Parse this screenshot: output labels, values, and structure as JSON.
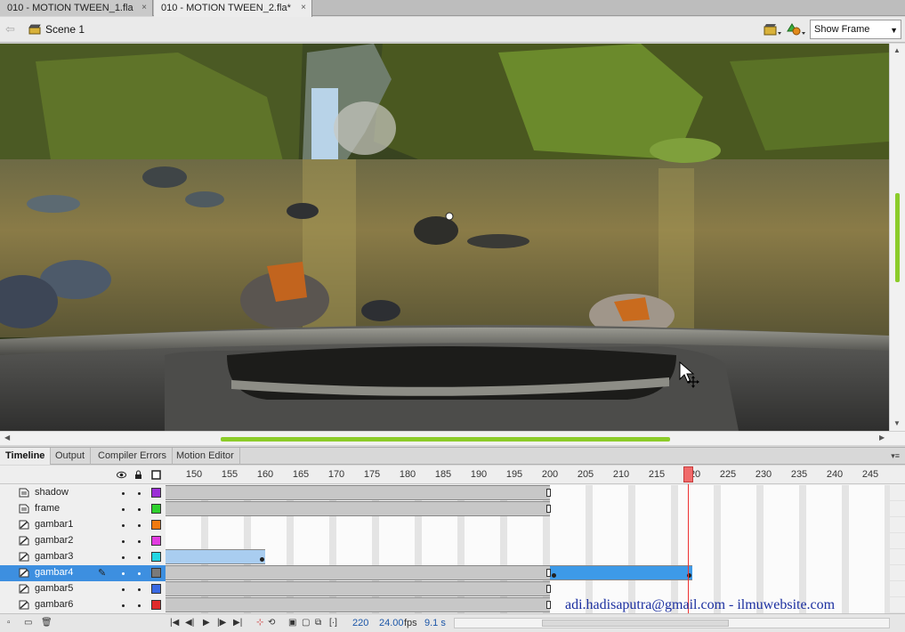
{
  "doc_tabs": [
    {
      "label": "010 - MOTION TWEEN_1.fla",
      "close": "×"
    },
    {
      "label": "010 - MOTION TWEEN_2.fla*",
      "close": "×"
    }
  ],
  "editbar": {
    "scene": "Scene 1",
    "zoom": "Show Frame",
    "icons": [
      "back-arrow-icon",
      "scene-clapper-icon",
      "edit-scene-icon",
      "edit-symbol-icon"
    ]
  },
  "panel_tabs": [
    "Timeline",
    "Output",
    "Compiler Errors",
    "Motion Editor"
  ],
  "ruler": [
    "150",
    "155",
    "160",
    "165",
    "170",
    "175",
    "180",
    "185",
    "190",
    "195",
    "200",
    "205",
    "210",
    "215",
    "220",
    "225",
    "230",
    "235",
    "240",
    "245"
  ],
  "layers": [
    {
      "name": "shadow",
      "color": "#9b2fd6"
    },
    {
      "name": "frame",
      "color": "#2ed12e"
    },
    {
      "name": "gambar1",
      "color": "#f07a10"
    },
    {
      "name": "gambar2",
      "color": "#e23be0"
    },
    {
      "name": "gambar3",
      "color": "#23d6e3"
    },
    {
      "name": "gambar4",
      "color": "#7a7a7a"
    },
    {
      "name": "gambar5",
      "color": "#3a6ae3"
    },
    {
      "name": "gambar6",
      "color": "#e02a2a"
    }
  ],
  "status": {
    "current_frame": "220",
    "fps": "24.00",
    "fps_unit": "fps",
    "time": "9.1 s"
  },
  "watermark": "adi.hadisaputra@gmail.com - ilmuwebsite.com",
  "colors": {
    "accent_green": "#8ccc2a",
    "selection_blue": "#3d8fe0",
    "playhead": "#ee3333"
  }
}
